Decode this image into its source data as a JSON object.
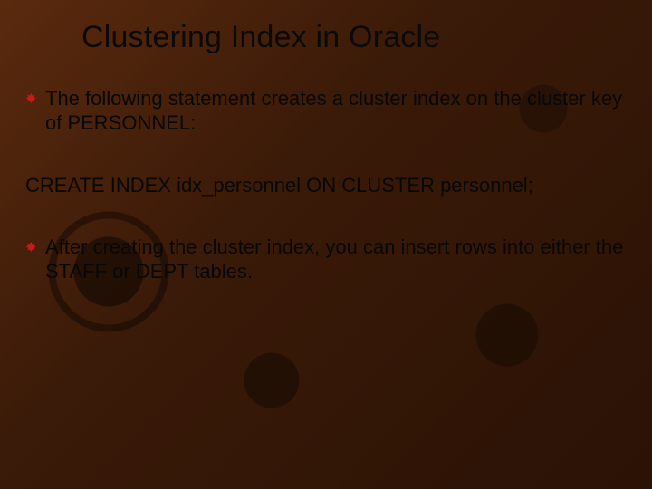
{
  "slide": {
    "title": "Clustering Index in Oracle",
    "bullets": [
      "The following statement creates a cluster index on the cluster key of PERSONNEL:",
      "After creating the cluster index, you can insert rows into either the STAFF or DEPT tables."
    ],
    "code": "CREATE INDEX idx_personnel ON CLUSTER personnel;",
    "bullet_glyph": "✸",
    "bullet_color": "#c71a1a"
  }
}
